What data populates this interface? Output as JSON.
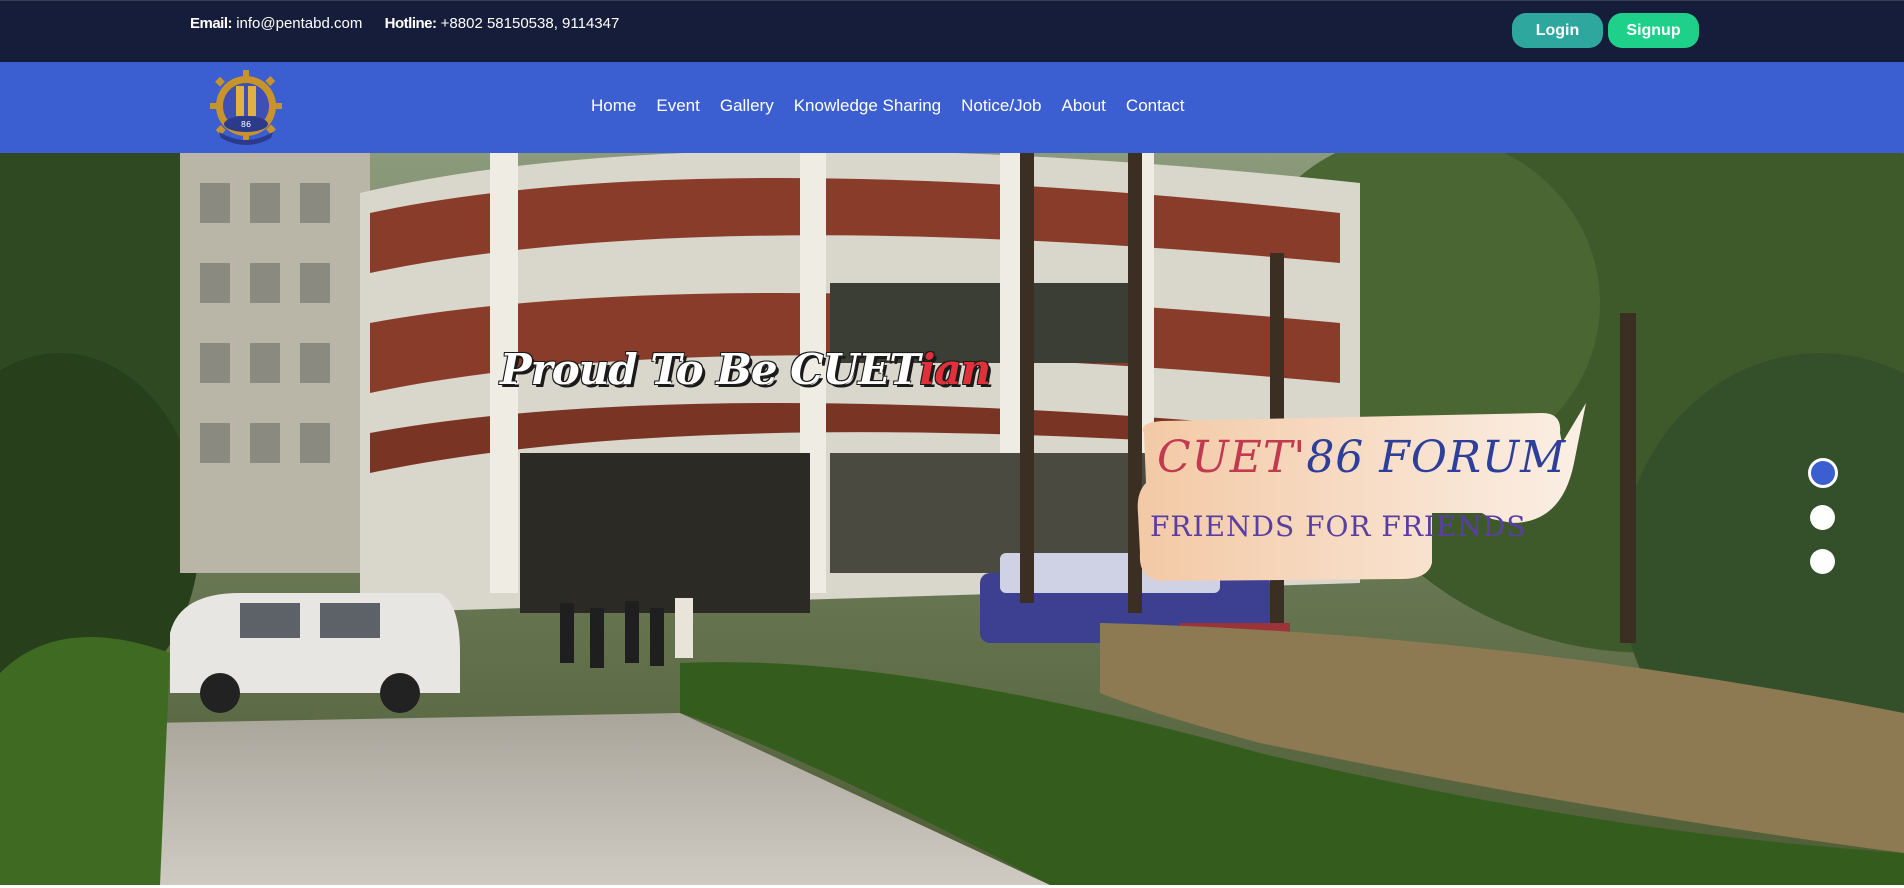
{
  "topbar": {
    "email_label": "Email:",
    "email_value": "info@pentabd.com",
    "hotline_label": "Hotline:",
    "hotline_value": "+8802 58150538, 9114347",
    "login_label": "Login",
    "signup_label": "Signup"
  },
  "nav": {
    "items": [
      "Home",
      "Event",
      "Gallery",
      "Knowledge Sharing",
      "Notice/Job",
      "About",
      "Contact"
    ]
  },
  "logo": {
    "text": "86"
  },
  "hero": {
    "tagline_main": "Proud To Be CUET",
    "tagline_accent": "ian",
    "banner_title_a": "CUET'",
    "banner_title_b": "86",
    "banner_title_c": " FORUM",
    "banner_subtitle": "FRIENDS  FOR  FRIENDS",
    "slides_count": 3,
    "active_slide": 1
  },
  "colors": {
    "topbar_bg": "#161d3b",
    "nav_bg": "#3b5fd0",
    "login_bg": "#2ea89f",
    "signup_bg": "#1fd08a"
  }
}
